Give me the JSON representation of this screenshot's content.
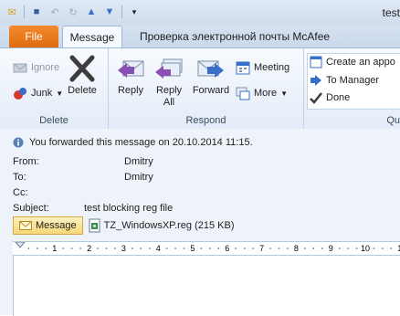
{
  "window": {
    "title": "test"
  },
  "tabs": {
    "file": "File",
    "message": "Message",
    "mcafee": "Проверка электронной почты McAfee"
  },
  "ribbon": {
    "delete_group": {
      "label": "Delete",
      "ignore": "Ignore",
      "junk": "Junk",
      "delete": "Delete"
    },
    "respond_group": {
      "label": "Respond",
      "reply": "Reply",
      "reply_all_1": "Reply",
      "reply_all_2": "All",
      "forward": "Forward",
      "meeting": "Meeting",
      "more": "More"
    },
    "quick_group": {
      "label": "Qu",
      "create": "Create an appo",
      "to_manager": "To Manager",
      "done": "Done"
    }
  },
  "message": {
    "info": "You forwarded this message on 20.10.2014 11:15.",
    "from_label": "From:",
    "from": "Dmitry",
    "to_label": "To:",
    "to": "Dmitry",
    "cc_label": "Cc:",
    "subject_label": "Subject:",
    "subject": "test blocking reg file",
    "message_tab": "Message",
    "attachment": "TZ_WindowsXP.reg (215 KB)"
  },
  "ruler": {
    "marks": [
      "1",
      "2",
      "3",
      "4",
      "5",
      "6",
      "7",
      "8",
      "9",
      "10",
      "1"
    ]
  }
}
